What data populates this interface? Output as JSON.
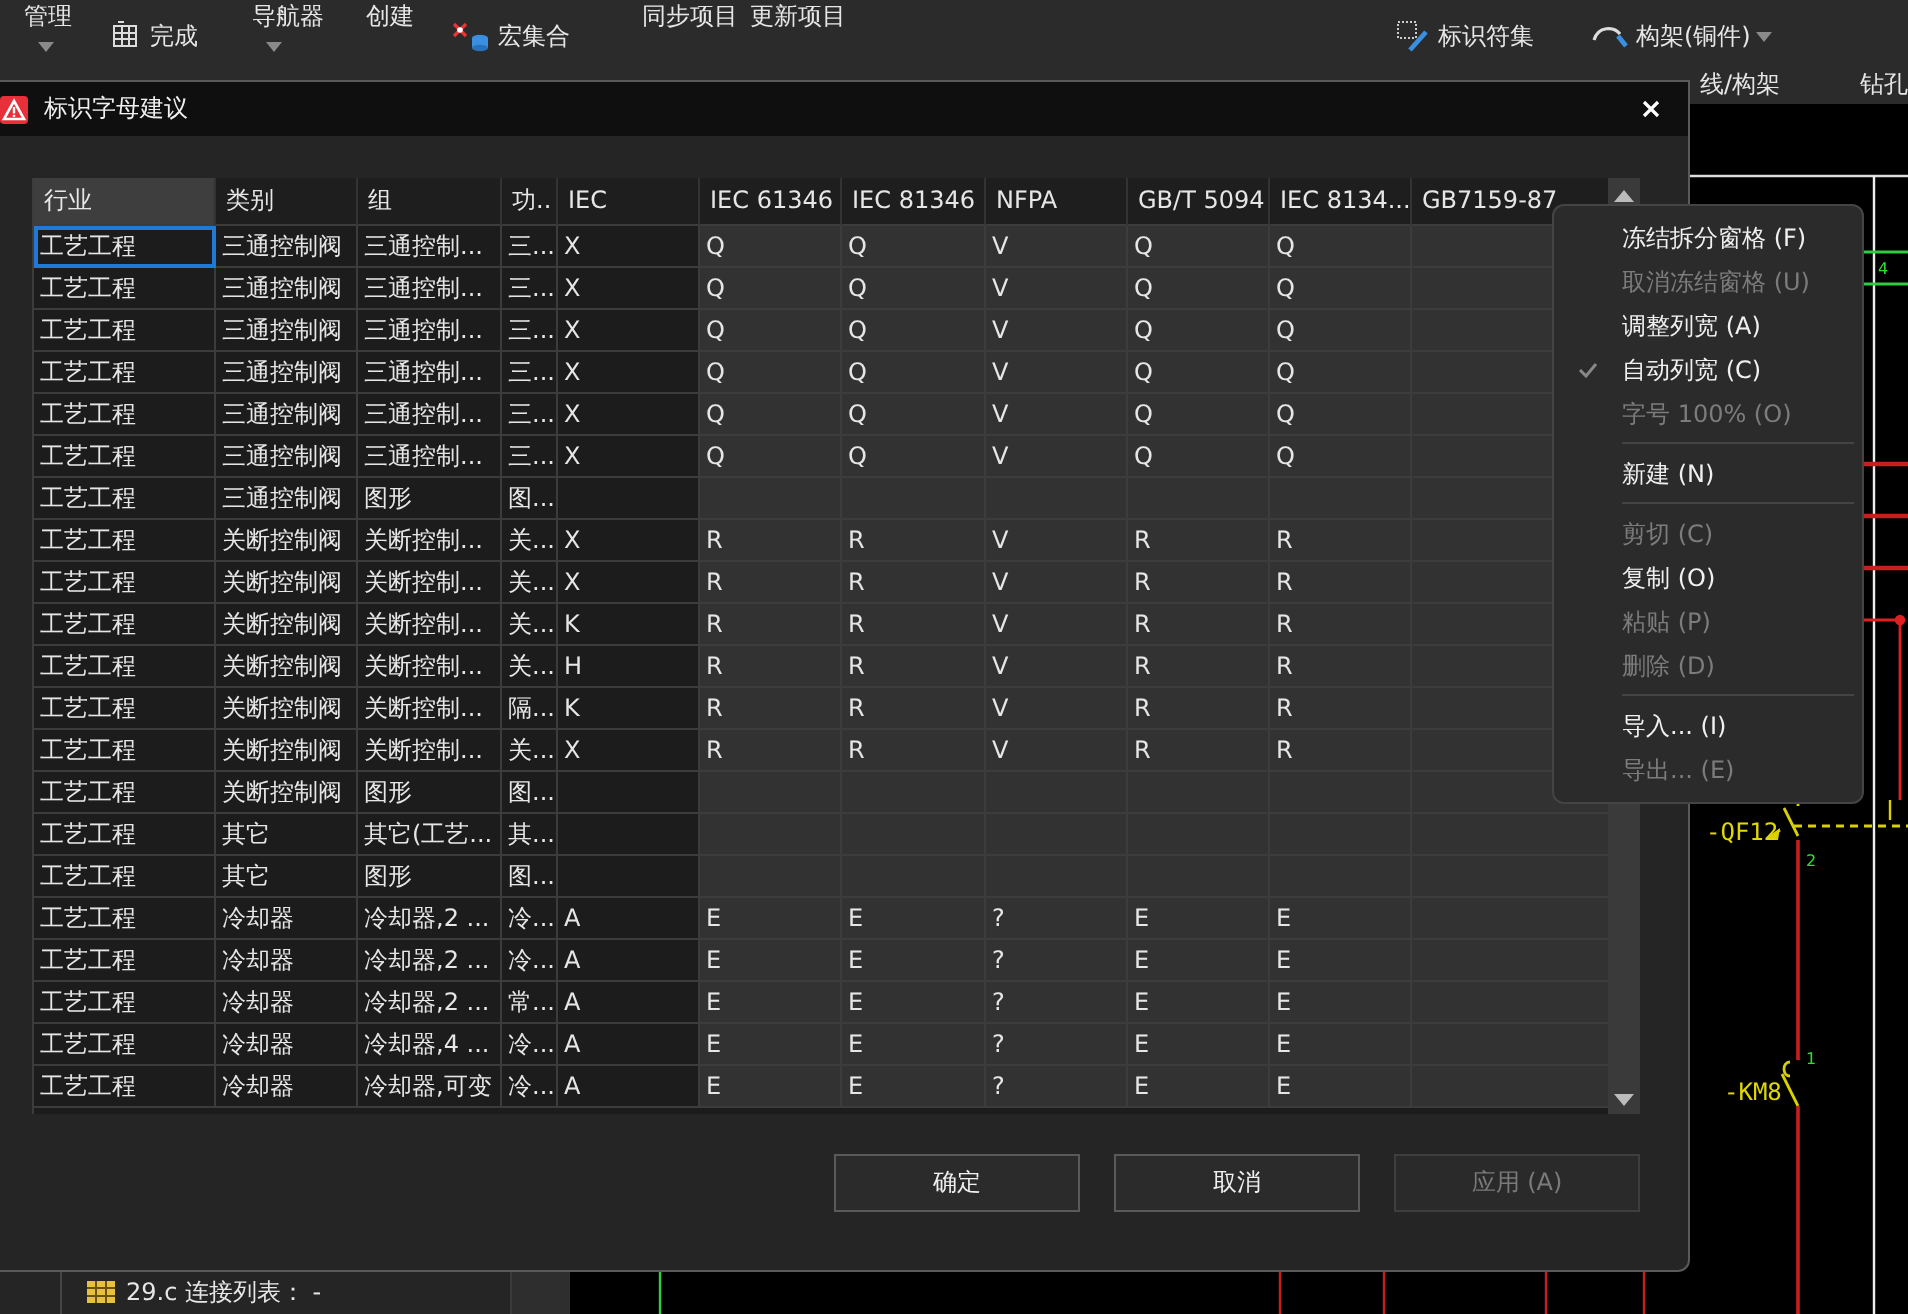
{
  "ribbon": {
    "items": [
      {
        "kind": "dropdown",
        "label": "管理"
      },
      {
        "kind": "icon",
        "label": "完成"
      },
      {
        "kind": "dropdown",
        "label": "导航器"
      },
      {
        "kind": "text",
        "label": "创建"
      },
      {
        "kind": "icon",
        "label": "宏集合"
      },
      {
        "kind": "text",
        "label": "同步项目"
      },
      {
        "kind": "text",
        "label": "更新项目"
      },
      {
        "kind": "icon",
        "label": "标识符集"
      },
      {
        "kind": "icon-dropdown",
        "label": "构架(铜件)"
      }
    ],
    "group_labels": [
      "线/构架",
      "钻孔"
    ]
  },
  "dialog": {
    "title": "标识字母建议",
    "table": {
      "columns": [
        {
          "label": "行业",
          "selected": true,
          "editable": false
        },
        {
          "label": "类别",
          "selected": false,
          "editable": false
        },
        {
          "label": "组",
          "selected": false,
          "editable": false
        },
        {
          "label": "功..",
          "selected": false,
          "editable": false
        },
        {
          "label": "IEC",
          "selected": false,
          "editable": false
        },
        {
          "label": "IEC 61346",
          "selected": false,
          "editable": true
        },
        {
          "label": "IEC 81346",
          "selected": false,
          "editable": true
        },
        {
          "label": "NFPA",
          "selected": false,
          "editable": true
        },
        {
          "label": "GB/T 5094",
          "selected": false,
          "editable": true
        },
        {
          "label": "IEC 8134...",
          "selected": false,
          "editable": true
        },
        {
          "label": "GB7159-87",
          "selected": false,
          "editable": true
        }
      ],
      "rows": [
        {
          "focused": true,
          "cells": [
            "工艺工程",
            "三通控制阀",
            "三通控制...",
            "三...",
            "X",
            "Q",
            "Q",
            "V",
            "Q",
            "Q",
            null
          ]
        },
        {
          "focused": false,
          "cells": [
            "工艺工程",
            "三通控制阀",
            "三通控制...",
            "三...",
            "X",
            "Q",
            "Q",
            "V",
            "Q",
            "Q",
            null
          ]
        },
        {
          "focused": false,
          "cells": [
            "工艺工程",
            "三通控制阀",
            "三通控制...",
            "三...",
            "X",
            "Q",
            "Q",
            "V",
            "Q",
            "Q",
            null
          ]
        },
        {
          "focused": false,
          "cells": [
            "工艺工程",
            "三通控制阀",
            "三通控制...",
            "三...",
            "X",
            "Q",
            "Q",
            "V",
            "Q",
            "Q",
            null
          ]
        },
        {
          "focused": false,
          "cells": [
            "工艺工程",
            "三通控制阀",
            "三通控制...",
            "三...",
            "X",
            "Q",
            "Q",
            "V",
            "Q",
            "Q",
            null
          ]
        },
        {
          "focused": false,
          "cells": [
            "工艺工程",
            "三通控制阀",
            "三通控制...",
            "三...",
            "X",
            "Q",
            "Q",
            "V",
            "Q",
            "Q",
            null
          ]
        },
        {
          "focused": false,
          "cells": [
            "工艺工程",
            "三通控制阀",
            "图形",
            "图...",
            null,
            null,
            null,
            null,
            null,
            null,
            null
          ]
        },
        {
          "focused": false,
          "cells": [
            "工艺工程",
            "关断控制阀",
            "关断控制...",
            "关...",
            "X",
            "R",
            "R",
            "V",
            "R",
            "R",
            null
          ]
        },
        {
          "focused": false,
          "cells": [
            "工艺工程",
            "关断控制阀",
            "关断控制...",
            "关...",
            "X",
            "R",
            "R",
            "V",
            "R",
            "R",
            null
          ]
        },
        {
          "focused": false,
          "cells": [
            "工艺工程",
            "关断控制阀",
            "关断控制...",
            "关...",
            "K",
            "R",
            "R",
            "V",
            "R",
            "R",
            null
          ]
        },
        {
          "focused": false,
          "cells": [
            "工艺工程",
            "关断控制阀",
            "关断控制...",
            "关...",
            "H",
            "R",
            "R",
            "V",
            "R",
            "R",
            null
          ]
        },
        {
          "focused": false,
          "cells": [
            "工艺工程",
            "关断控制阀",
            "关断控制...",
            "隔...",
            "K",
            "R",
            "R",
            "V",
            "R",
            "R",
            null
          ]
        },
        {
          "focused": false,
          "cells": [
            "工艺工程",
            "关断控制阀",
            "关断控制...",
            "关...",
            "X",
            "R",
            "R",
            "V",
            "R",
            "R",
            null
          ]
        },
        {
          "focused": false,
          "cells": [
            "工艺工程",
            "关断控制阀",
            "图形",
            "图...",
            null,
            null,
            null,
            null,
            null,
            null,
            null
          ]
        },
        {
          "focused": false,
          "cells": [
            "工艺工程",
            "其它",
            "其它(工艺...",
            "其...",
            null,
            null,
            null,
            null,
            null,
            null,
            null
          ]
        },
        {
          "focused": false,
          "cells": [
            "工艺工程",
            "其它",
            "图形",
            "图...",
            null,
            null,
            null,
            null,
            null,
            null,
            null
          ]
        },
        {
          "focused": false,
          "cells": [
            "工艺工程",
            "冷却器",
            "冷却器,2 ...",
            "冷...",
            "A",
            "E",
            "E",
            "?",
            "E",
            "E",
            null
          ]
        },
        {
          "focused": false,
          "cells": [
            "工艺工程",
            "冷却器",
            "冷却器,2 ...",
            "冷...",
            "A",
            "E",
            "E",
            "?",
            "E",
            "E",
            null
          ]
        },
        {
          "focused": false,
          "cells": [
            "工艺工程",
            "冷却器",
            "冷却器,2 ...",
            "常...",
            "A",
            "E",
            "E",
            "?",
            "E",
            "E",
            null
          ]
        },
        {
          "focused": false,
          "cells": [
            "工艺工程",
            "冷却器",
            "冷却器,4 ...",
            "冷...",
            "A",
            "E",
            "E",
            "?",
            "E",
            "E",
            null
          ]
        },
        {
          "focused": false,
          "cells": [
            "工艺工程",
            "冷却器",
            "冷却器,可变",
            "冷...",
            "A",
            "E",
            "E",
            "?",
            "E",
            "E",
            null
          ]
        }
      ]
    },
    "buttons": [
      {
        "label": "确定",
        "disabled": false
      },
      {
        "label": "取消",
        "disabled": false
      },
      {
        "label": "应用 (A)",
        "disabled": true
      }
    ]
  },
  "context_menu": {
    "items": [
      {
        "kind": "item",
        "label": "冻结拆分窗格 (F)",
        "disabled": false,
        "checked": false
      },
      {
        "kind": "item",
        "label": "取消冻结窗格 (U)",
        "disabled": true,
        "checked": false
      },
      {
        "kind": "item",
        "label": "调整列宽 (A)",
        "disabled": false,
        "checked": false
      },
      {
        "kind": "item",
        "label": "自动列宽 (C)",
        "disabled": false,
        "checked": true
      },
      {
        "kind": "item",
        "label": "字号 100% (O)",
        "disabled": true,
        "checked": false
      },
      {
        "kind": "separator"
      },
      {
        "kind": "item",
        "label": "新建 (N)",
        "disabled": false,
        "checked": false
      },
      {
        "kind": "separator"
      },
      {
        "kind": "item",
        "label": "剪切 (C)",
        "disabled": true,
        "checked": false
      },
      {
        "kind": "item",
        "label": "复制 (O)",
        "disabled": false,
        "checked": false
      },
      {
        "kind": "item",
        "label": "粘贴 (P)",
        "disabled": true,
        "checked": false
      },
      {
        "kind": "item",
        "label": "删除 (D)",
        "disabled": true,
        "checked": false
      },
      {
        "kind": "separator"
      },
      {
        "kind": "item",
        "label": "导入... (I)",
        "disabled": false,
        "checked": false
      },
      {
        "kind": "item",
        "label": "导出... (E)",
        "disabled": true,
        "checked": false
      }
    ]
  },
  "tree": {
    "items": [
      {
        "label": "29.c 连接列表： -"
      }
    ]
  },
  "schematic": {
    "labels": [
      {
        "kind": "device",
        "text": "-QF12"
      },
      {
        "kind": "device",
        "text": "-KM8"
      },
      {
        "kind": "pin",
        "text": "4"
      },
      {
        "kind": "pin",
        "text": "2"
      },
      {
        "kind": "pin",
        "text": "1"
      }
    ]
  }
}
